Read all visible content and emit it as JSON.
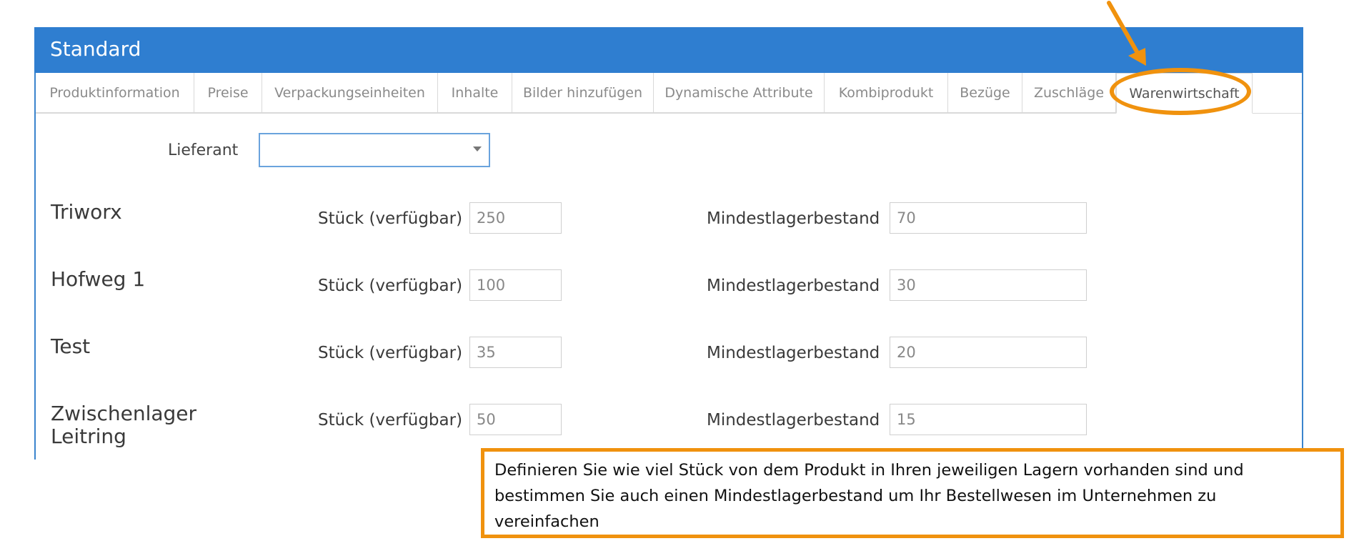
{
  "header": {
    "title": "Standard"
  },
  "tabs": [
    {
      "label": "Produktinformation"
    },
    {
      "label": "Preise"
    },
    {
      "label": "Verpackungseinheiten"
    },
    {
      "label": "Inhalte"
    },
    {
      "label": "Bilder hinzufügen"
    },
    {
      "label": "Dynamische Attribute"
    },
    {
      "label": "Kombiprodukt"
    },
    {
      "label": "Bezüge"
    },
    {
      "label": "Zuschläge"
    },
    {
      "label": "Warenwirtschaft",
      "active": true
    }
  ],
  "supplier": {
    "label": "Lieferant",
    "value": ""
  },
  "warehouses": [
    {
      "name": "Triworx",
      "stock_label": "Stück (verfügbar)",
      "stock": "250",
      "min_label": "Mindestlagerbestand",
      "min": "70"
    },
    {
      "name": "Hofweg 1",
      "stock_label": "Stück (verfügbar)",
      "stock": "100",
      "min_label": "Mindestlagerbestand",
      "min": "30"
    },
    {
      "name": "Test",
      "stock_label": "Stück (verfügbar)",
      "stock": "35",
      "min_label": "Mindestlagerbestand",
      "min": "20"
    },
    {
      "name": "Zwischenlager Leitring",
      "stock_label": "Stück (verfügbar)",
      "stock": "50",
      "min_label": "Mindestlagerbestand",
      "min": "15"
    }
  ],
  "callout": {
    "line1": "Definieren Sie wie viel Stück von dem Produkt in Ihren jeweiligen Lagern vorhanden sind und",
    "line2": "bestimmen Sie auch einen Mindestlagerbestand um Ihr Bestellwesen im Unternehmen zu",
    "line3": "vereinfachen"
  },
  "colors": {
    "header_blue": "#2f7ed0",
    "annotation_orange": "#f0920e"
  },
  "icons": {
    "select_caret": "chevron-down-icon",
    "annotation_arrow": "arrow-icon"
  }
}
